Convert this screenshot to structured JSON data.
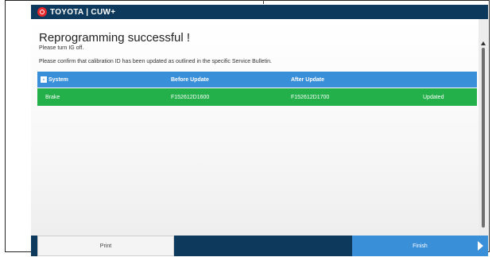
{
  "header": {
    "brand": "TOYOTA | CUW+",
    "logo_color": "#e3262a",
    "bar_color": "#0d3a5c"
  },
  "page": {
    "title": "Reprogramming successful !",
    "subtitle": "Please turn IG off.",
    "info": "Please confirm that calibration ID has been updated as outlined in the specific Service Bulletin."
  },
  "table": {
    "collapse_symbol": "-",
    "headers": [
      "System",
      "Before Update",
      "After Update",
      ""
    ],
    "rows": [
      {
        "system": "Brake",
        "before": "F152612D1600",
        "after": "F152612D1700",
        "status": "Updated"
      }
    ],
    "header_color": "#3a8fd9",
    "row_color": "#23b04a"
  },
  "footer": {
    "print_label": "Print",
    "finish_label": "Finish",
    "finish_icon": "arrow-right-icon"
  }
}
